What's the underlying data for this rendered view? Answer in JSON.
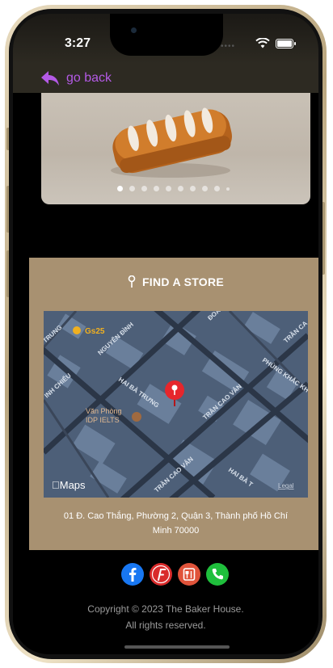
{
  "status_bar": {
    "time": "3:27"
  },
  "nav": {
    "back_label": "go back"
  },
  "carousel": {
    "total_slides": 10,
    "active_index": 0
  },
  "store": {
    "title": "FIND A STORE",
    "address_line1": "01 Đ. Cao Thắng, Phường 2, Quận 3, Thành phố Hồ Chí",
    "address_line2": "Minh 70000"
  },
  "map": {
    "poi_gs25": "Gs25",
    "poi_idp_line1": "Văn Phòng",
    "poi_idp_line2": "IDP IELTS",
    "street_nguyen_dinh": "NGUYỄN ĐÌNH",
    "street_hai_ba_trung": "HAI BÀ TRƯNG",
    "street_hai_ba_trung_2": "HAI BÀ T",
    "street_tran_cao_van": "TRẦN CAO VÂN",
    "street_tran_cao_van_2": "TRẦN CAO VÂN",
    "street_phung_khac_khoan": "PHÙNG KHẮC KH",
    "street_trung": "TRUNG",
    "street_inh_chieu": "INH CHIỂU",
    "street_tran_ca": "TRẦN CA",
    "street_doan": "ĐOÀN",
    "maps_logo": "Maps",
    "legal": "Legal"
  },
  "socials": [
    {
      "name": "facebook",
      "color": "#1877f2"
    },
    {
      "name": "foody",
      "color": "#d92b2b"
    },
    {
      "name": "restaurant",
      "color": "#e0533a"
    },
    {
      "name": "phone",
      "color": "#1fbf3c"
    }
  ],
  "footer": {
    "copyright_line1": "Copyright © 2023 The Baker House.",
    "copyright_line2": "All rights reserved."
  },
  "colors": {
    "accent": "#b45ae6",
    "store_bg": "#a89171",
    "map_bg": "#4d5f78"
  }
}
